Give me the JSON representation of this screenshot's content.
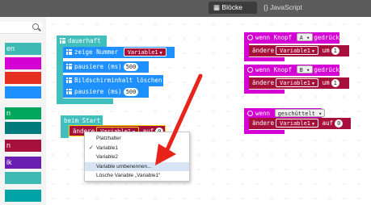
{
  "header": {
    "tab_blocks": "Blöcke",
    "tab_javascript": "{} JavaScript",
    "blocks_icon": "blocks-icon"
  },
  "toolbox": {
    "search_placeholder": "",
    "search_icon": "search-icon",
    "items": [
      {
        "label": "en",
        "color": "#3fb9b4"
      },
      {
        "label": "",
        "color": "#d400d4"
      },
      {
        "label": "",
        "color": "#e63022"
      },
      {
        "label": "",
        "color": "#1e90ff"
      },
      {
        "label": "n",
        "color": "#00a65c"
      },
      {
        "label": "",
        "color": "#007a7a"
      },
      {
        "label": "n",
        "color": "#a6103a"
      },
      {
        "label": "ik",
        "color": "#6b1fb2"
      },
      {
        "label": "",
        "color": "#3fb9b4"
      },
      {
        "label": "",
        "color": "#00a4a6"
      }
    ]
  },
  "blocks": {
    "dauerhaft": "dauerhaft",
    "zeige_nummer": "zeige Nummer",
    "var_name": "Variable1",
    "pausiere": "pausiere (ms)",
    "pause_val": "500",
    "bildschirm": "Bildschirminhalt löschen",
    "wenn_knopf": "wenn Knopf",
    "knopf_a": "A",
    "knopf_b": "B",
    "gedrueckt": "gedrückt",
    "aendere": "ändere",
    "um": "um",
    "um_val": "1",
    "wenn": "wenn",
    "geschuettelt": "geschüttelt",
    "auf": "auf",
    "auf_val": "0",
    "beim_start": "beim Start"
  },
  "dropdown": {
    "items": [
      {
        "label": "Platzhalter",
        "checked": false,
        "highlighted": false
      },
      {
        "label": "Variable1",
        "checked": true,
        "highlighted": false
      },
      {
        "label": "Variable2",
        "checked": false,
        "highlighted": false
      },
      {
        "label": "Variable umbenennen...",
        "checked": false,
        "highlighted": true
      },
      {
        "label": "Lösche Variable „Variable1“",
        "checked": false,
        "highlighted": false
      }
    ],
    "check_mark": "✓"
  },
  "colors": {
    "annotation_arrow": "#e8231a",
    "cyan": "#40bfbc",
    "magenta": "#d400d4",
    "variable": "#a6103a"
  }
}
